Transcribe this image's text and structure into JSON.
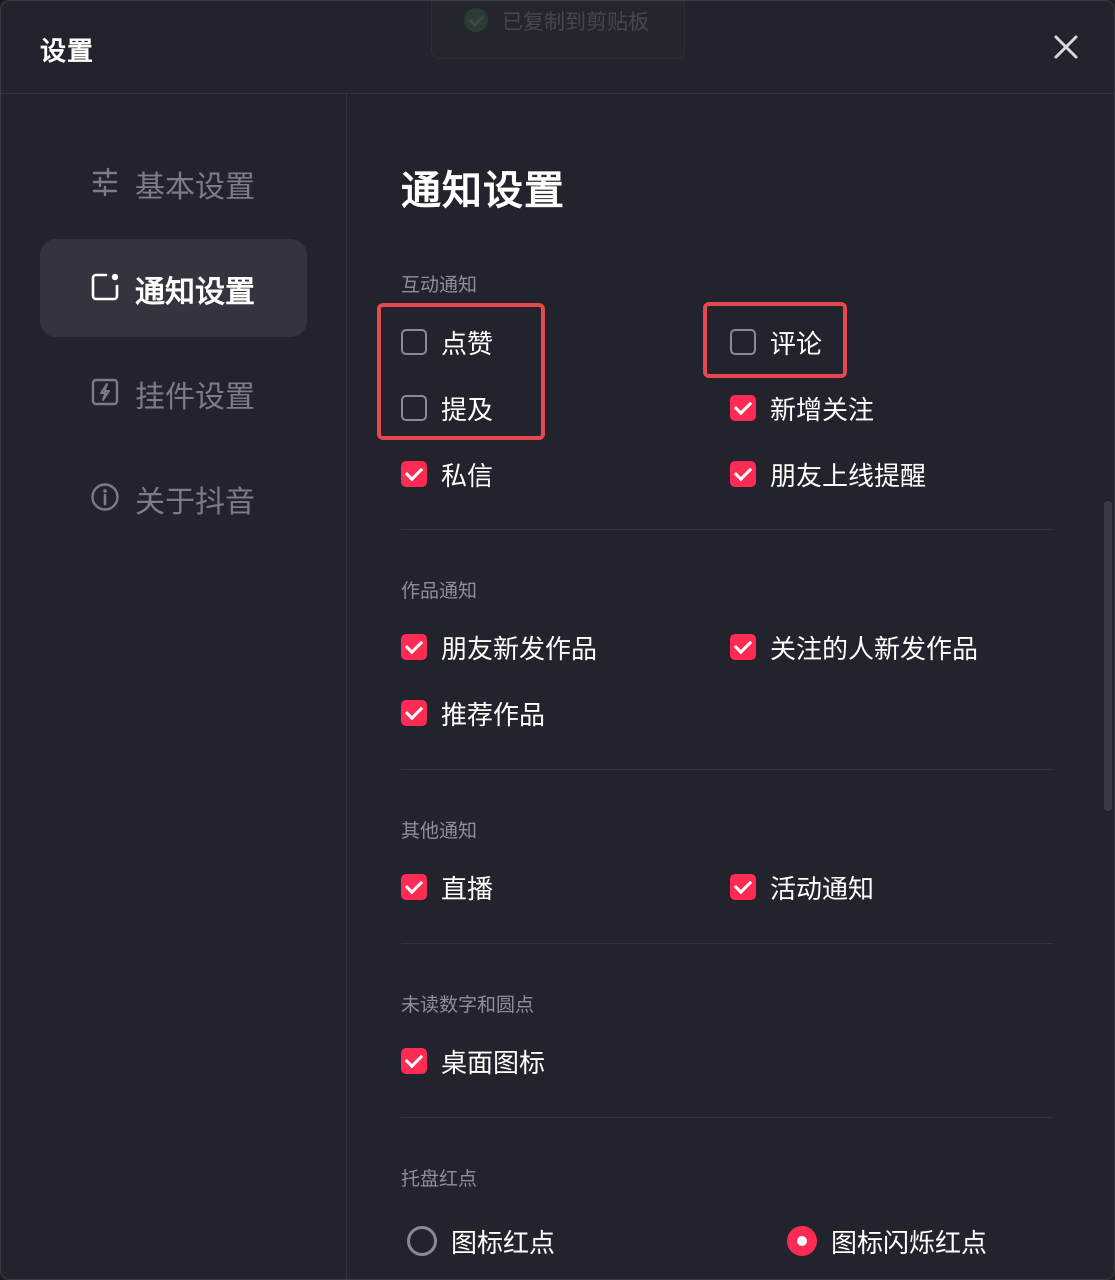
{
  "window": {
    "title": "设置"
  },
  "toast": {
    "text": "已复制到剪贴板",
    "icon": "check-circle-icon"
  },
  "sidebar": {
    "items": [
      {
        "label": "基本设置",
        "icon": "sliders-icon",
        "active": false
      },
      {
        "label": "通知设置",
        "icon": "notification-icon",
        "active": true
      },
      {
        "label": "挂件设置",
        "icon": "widget-bolt-icon",
        "active": false
      },
      {
        "label": "关于抖音",
        "icon": "info-icon",
        "active": false
      }
    ]
  },
  "main": {
    "title": "通知设置",
    "sections": {
      "interaction": {
        "label": "互动通知",
        "options": [
          {
            "label": "点赞",
            "checked": false
          },
          {
            "label": "评论",
            "checked": false
          },
          {
            "label": "提及",
            "checked": false
          },
          {
            "label": "新增关注",
            "checked": true
          },
          {
            "label": "私信",
            "checked": true
          },
          {
            "label": "朋友上线提醒",
            "checked": true
          }
        ]
      },
      "works": {
        "label": "作品通知",
        "options": [
          {
            "label": "朋友新发作品",
            "checked": true
          },
          {
            "label": "关注的人新发作品",
            "checked": true
          },
          {
            "label": "推荐作品",
            "checked": true
          }
        ]
      },
      "other": {
        "label": "其他通知",
        "options": [
          {
            "label": "直播",
            "checked": true
          },
          {
            "label": "活动通知",
            "checked": true
          }
        ]
      },
      "unread": {
        "label": "未读数字和圆点",
        "options": [
          {
            "label": "桌面图标",
            "checked": true
          }
        ]
      },
      "tray": {
        "label": "托盘红点",
        "options": [
          {
            "label": "图标红点",
            "selected": false
          },
          {
            "label": "图标闪烁红点",
            "selected": true
          }
        ]
      }
    }
  },
  "colors": {
    "accent": "#fe2c55",
    "highlight": "#e4474d",
    "background": "#23232d"
  }
}
